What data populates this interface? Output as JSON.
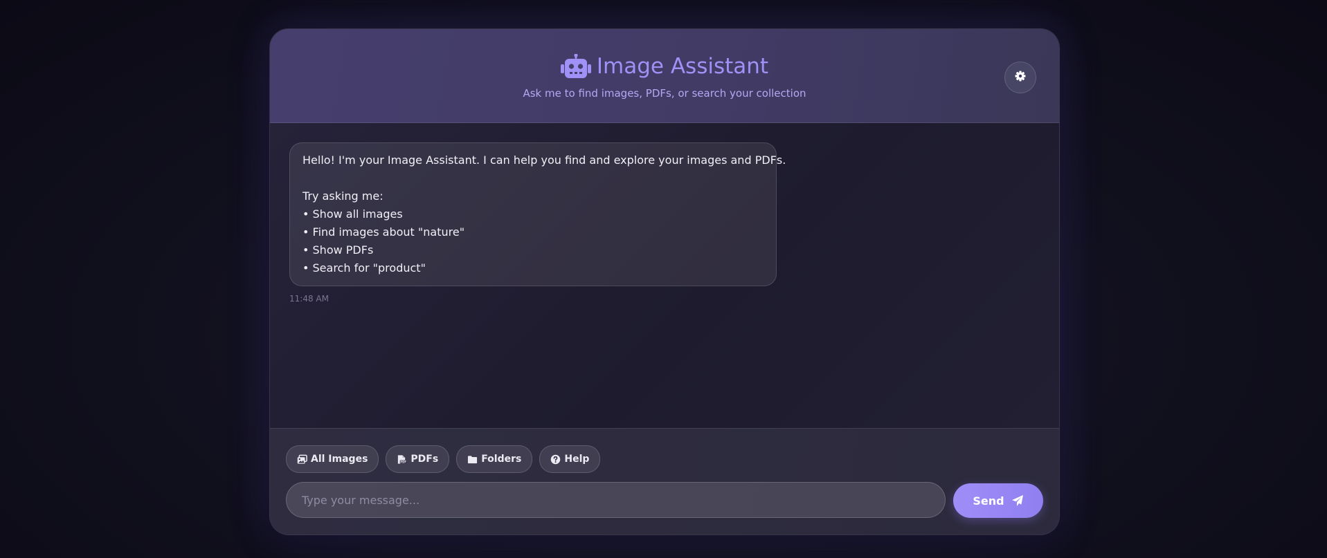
{
  "header": {
    "title": "Image Assistant",
    "subtitle": "Ask me to find images, PDFs, or search your collection",
    "icon": "robot-icon",
    "settings_icon": "gear-icon"
  },
  "messages": [
    {
      "sender": "assistant",
      "lines": [
        "Hello! I'm your Image Assistant. I can help you find and explore your images and PDFs.",
        "",
        "Try asking me:",
        "• Show all images",
        "• Find images about \"nature\"",
        "• Show PDFs",
        "• Search for \"product\""
      ],
      "time": "11:48 AM"
    }
  ],
  "quick_actions": [
    {
      "label": "All Images",
      "icon": "images-icon"
    },
    {
      "label": "PDFs",
      "icon": "pdf-file-icon"
    },
    {
      "label": "Folders",
      "icon": "folder-icon"
    },
    {
      "label": "Help",
      "icon": "help-circle-icon"
    }
  ],
  "composer": {
    "placeholder": "Type your message...",
    "value": "",
    "send_label": "Send",
    "send_icon": "paper-plane-icon"
  },
  "colors": {
    "accent": "#9f91f5",
    "send_button": "#9a89f5",
    "header_bg": "#453e6c",
    "page_bg": "#12111f"
  }
}
